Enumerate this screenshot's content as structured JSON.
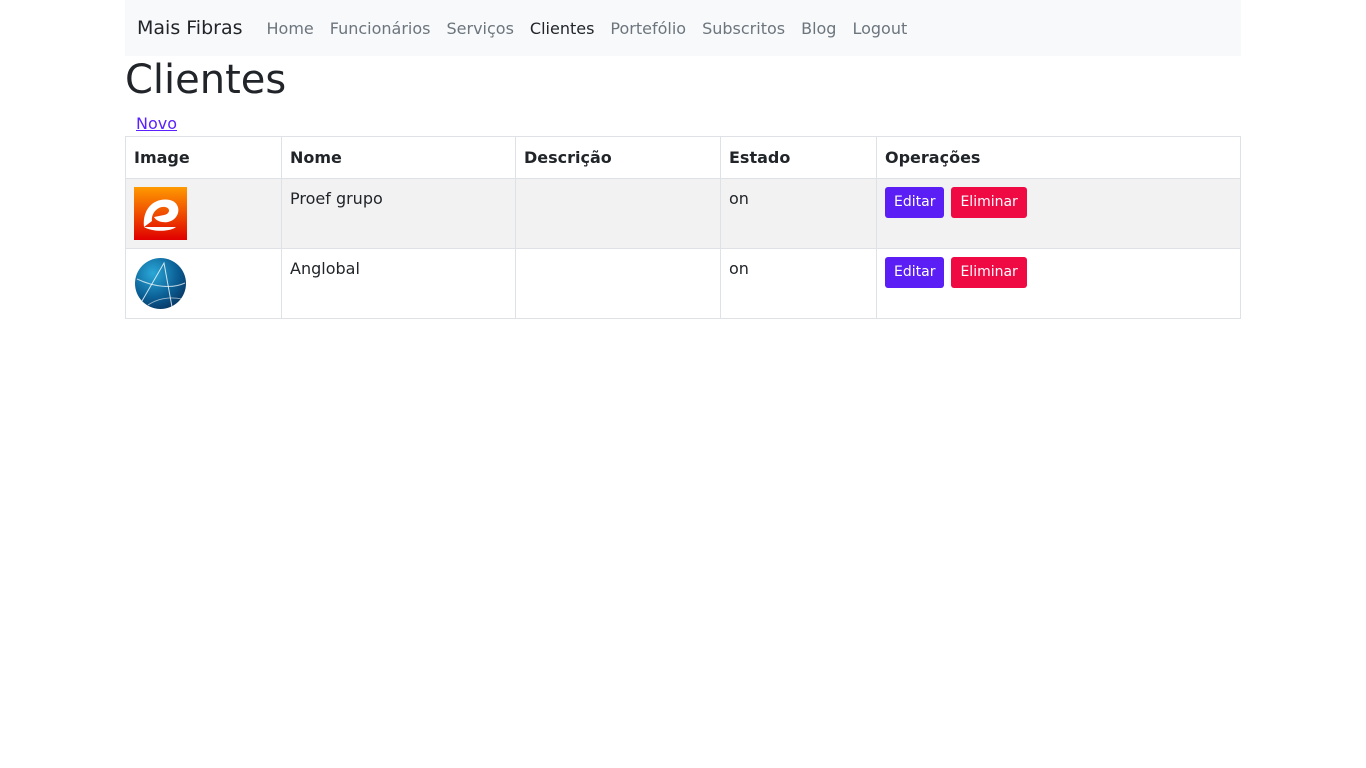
{
  "navbar": {
    "brand": "Mais Fibras",
    "links": [
      {
        "label": "Home",
        "active": false
      },
      {
        "label": "Funcionários",
        "active": false
      },
      {
        "label": "Serviços",
        "active": false
      },
      {
        "label": "Clientes",
        "active": true
      },
      {
        "label": "Portefólio",
        "active": false
      },
      {
        "label": "Subscritos",
        "active": false
      },
      {
        "label": "Blog",
        "active": false
      },
      {
        "label": "Logout",
        "active": false
      }
    ]
  },
  "page": {
    "title": "Clientes",
    "new_link": "Novo"
  },
  "table": {
    "headers": [
      "Image",
      "Nome",
      "Descrição",
      "Estado",
      "Operações"
    ],
    "rows": [
      {
        "image": "proef-logo",
        "nome": "Proef grupo",
        "descricao": "",
        "estado": "on",
        "edit_label": "Editar",
        "delete_label": "Eliminar"
      },
      {
        "image": "anglobal-logo",
        "nome": "Anglobal",
        "descricao": "",
        "estado": "on",
        "edit_label": "Editar",
        "delete_label": "Eliminar"
      }
    ]
  },
  "colors": {
    "edit_button": "#5b1ef5",
    "delete_button": "#ef0a43",
    "link": "#5b21ff",
    "navbar_bg": "#f8f9fa"
  }
}
